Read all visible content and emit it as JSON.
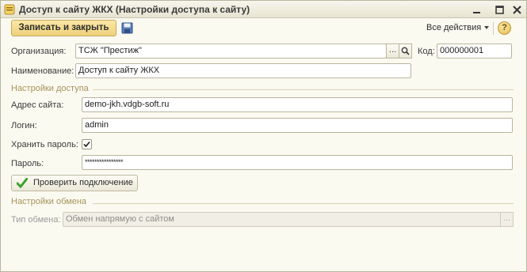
{
  "window": {
    "title": "Доступ к сайту ЖКХ (Настройки доступа к сайту)"
  },
  "toolbar": {
    "save_close_label": "Записать и закрыть",
    "all_actions_label": "Все действия",
    "help_glyph": "?"
  },
  "form": {
    "organization": {
      "label": "Организация:",
      "value": "ТСЖ \"Престиж\"",
      "select_glyph": "...",
      "search_icon": "magnifier-icon"
    },
    "code": {
      "label": "Код:",
      "value": "000000001"
    },
    "name": {
      "label": "Наименование:",
      "value": "Доступ к сайту ЖКХ"
    },
    "access_section": {
      "title": "Настройки доступа"
    },
    "site_address": {
      "label": "Адрес сайта:",
      "value": "demo-jkh.vdgb-soft.ru"
    },
    "login": {
      "label": "Логин:",
      "value": "admin"
    },
    "save_password": {
      "label": "Хранить пароль:",
      "checked": true
    },
    "password": {
      "label": "Пароль:",
      "value": "****************"
    },
    "check_connection": {
      "label": "Проверить подключение"
    },
    "exchange_section": {
      "title": "Настройки обмена"
    },
    "exchange_type": {
      "label": "Тип обмена:",
      "value": "Обмен напрямую с сайтом",
      "select_glyph": "..."
    }
  },
  "colors": {
    "accent": "#eed07a",
    "section_title": "#a8925c",
    "window_bg": "#fbfaf1"
  }
}
